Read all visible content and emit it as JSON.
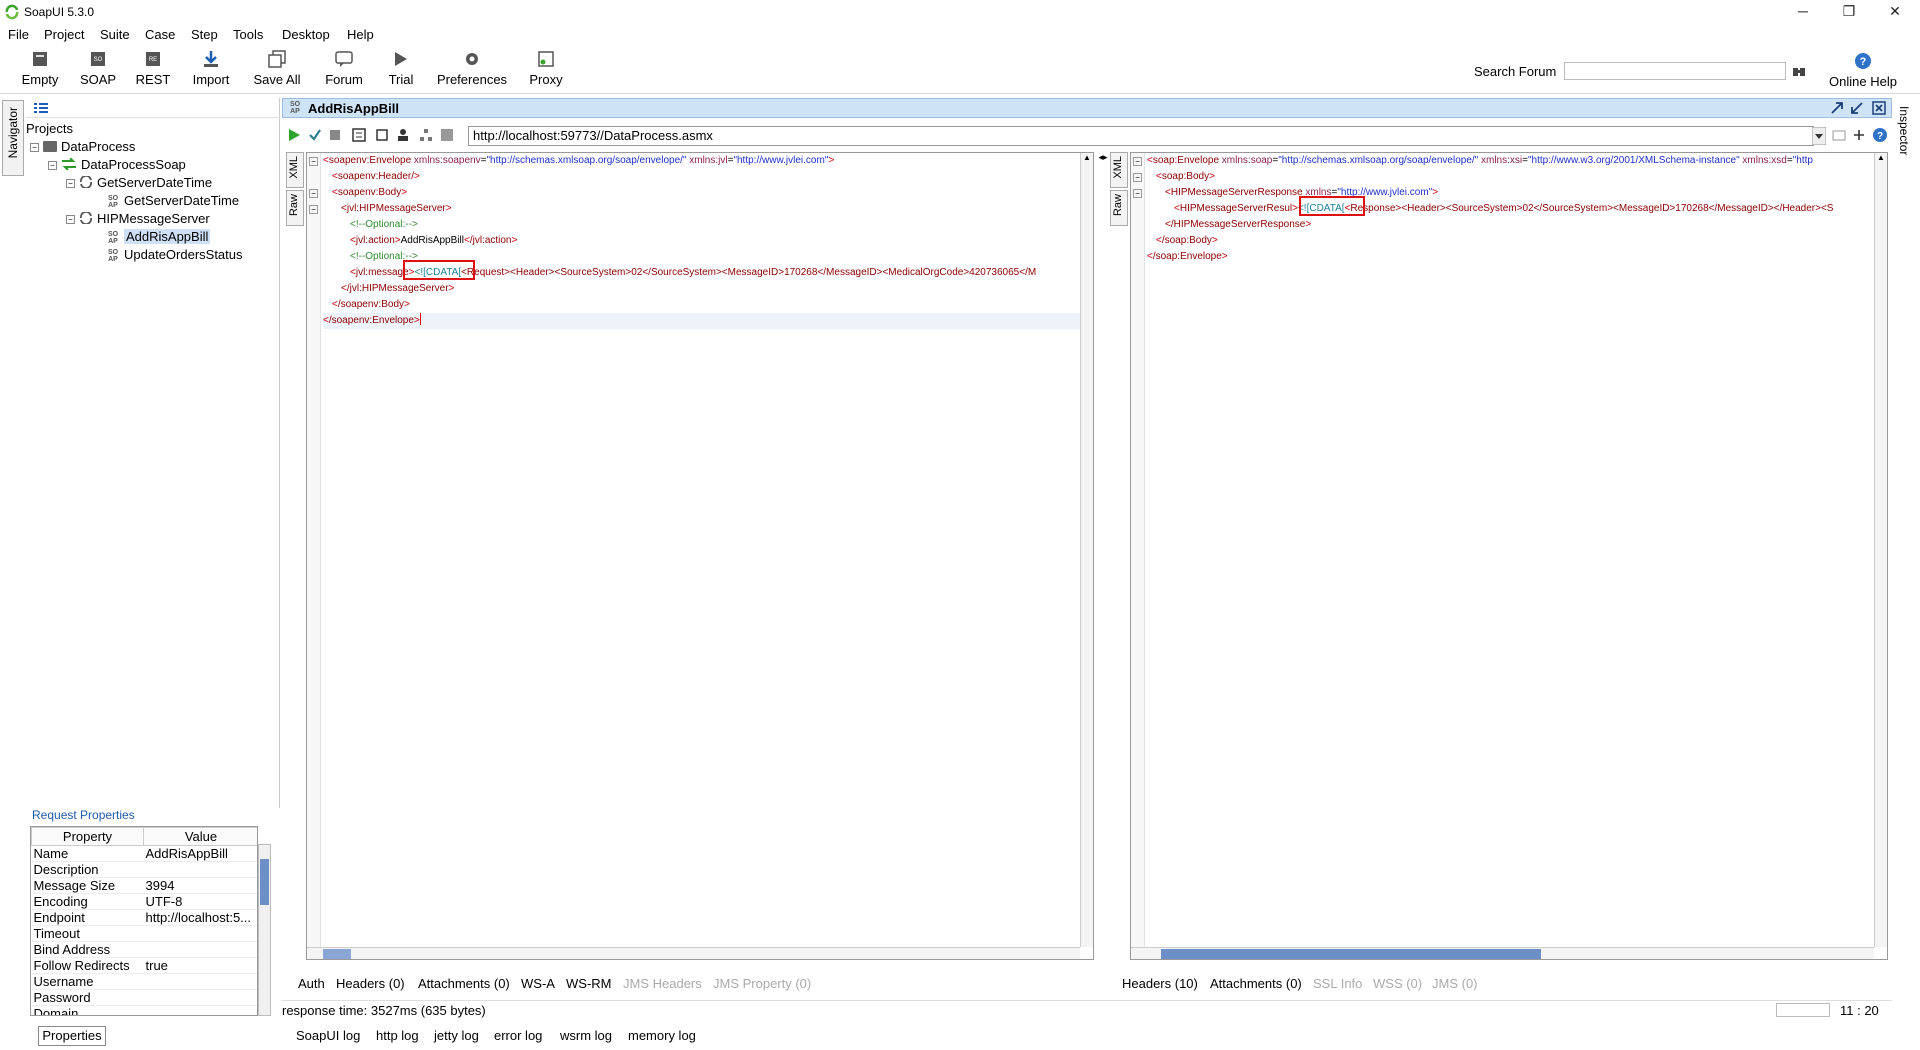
{
  "window": {
    "title": "SoapUI 5.3.0",
    "controls": {
      "minimize": "─",
      "restore": "❐",
      "close": "✕"
    }
  },
  "menu": {
    "items": [
      {
        "label": "File"
      },
      {
        "label": "Project"
      },
      {
        "label": "Suite"
      },
      {
        "label": "Case"
      },
      {
        "label": "Step"
      },
      {
        "label": "Tools"
      },
      {
        "label": "Desktop"
      },
      {
        "label": "Help"
      }
    ]
  },
  "toolbar": {
    "buttons": [
      {
        "label": "Empty",
        "icon": "empty-project-icon"
      },
      {
        "label": "SOAP",
        "icon": "soap-project-icon"
      },
      {
        "label": "REST",
        "icon": "rest-project-icon"
      },
      {
        "label": "Import",
        "icon": "import-icon"
      },
      {
        "label": "Save All",
        "icon": "save-all-icon"
      },
      {
        "label": "Forum",
        "icon": "forum-icon"
      },
      {
        "label": "Trial",
        "icon": "trial-icon"
      },
      {
        "label": "Preferences",
        "icon": "gear-icon"
      },
      {
        "label": "Proxy",
        "icon": "proxy-icon"
      }
    ],
    "search_label": "Search Forum",
    "search_value": "",
    "online_help": "Online Help"
  },
  "side": {
    "navigator": "Navigator",
    "inspector": "Inspector"
  },
  "navigator": {
    "root": "Projects",
    "project": "DataProcess",
    "interface": "DataProcessSoap",
    "operations": [
      {
        "name": "GetServerDateTime",
        "request": "GetServerDateTime"
      },
      {
        "name": "HIPMessageServer",
        "requests": [
          "AddRisAppBill",
          "UpdateOrdersStatus"
        ]
      }
    ],
    "soap_badge_top": "SO",
    "soap_badge_bottom": "AP"
  },
  "request_properties": {
    "title": "Request Properties",
    "headers": [
      "Property",
      "Value"
    ],
    "rows": [
      [
        "Name",
        "AddRisAppBill"
      ],
      [
        "Description",
        ""
      ],
      [
        "Message Size",
        "3994"
      ],
      [
        "Encoding",
        "UTF-8"
      ],
      [
        "Endpoint",
        "http://localhost:5..."
      ],
      [
        "Timeout",
        ""
      ],
      [
        "Bind Address",
        ""
      ],
      [
        "Follow Redirects",
        "true"
      ],
      [
        "Username",
        ""
      ],
      [
        "Password",
        ""
      ],
      [
        "Domain",
        ""
      ]
    ],
    "properties_button": "Properties"
  },
  "editor": {
    "title": "AddRisAppBill",
    "endpoint_url": "http://localhost:59773//DataProcess.asmx",
    "request_tabs": {
      "xml": "XML",
      "raw": "Raw"
    },
    "response_tabs": {
      "xml": "XML",
      "raw": "Raw"
    },
    "request_bottom_tabs": [
      {
        "label": "Auth",
        "enabled": true
      },
      {
        "label": "Headers (0)",
        "enabled": true
      },
      {
        "label": "Attachments (0)",
        "enabled": true
      },
      {
        "label": "WS-A",
        "enabled": true
      },
      {
        "label": "WS-RM",
        "enabled": true
      },
      {
        "label": "JMS Headers",
        "enabled": false
      },
      {
        "label": "JMS Property (0)",
        "enabled": false
      }
    ],
    "response_bottom_tabs": [
      {
        "label": "Headers (10)",
        "enabled": true
      },
      {
        "label": "Attachments (0)",
        "enabled": true
      },
      {
        "label": "SSL Info",
        "enabled": false
      },
      {
        "label": "WSS (0)",
        "enabled": false
      },
      {
        "label": "JMS (0)",
        "enabled": false
      }
    ]
  },
  "request_xml": {
    "line1_tag": "soapenv:Envelope",
    "line1_attr1_name": "xmlns:soapenv",
    "line1_attr1_value": "\"http://schemas.xmlsoap.org/soap/envelope/\"",
    "line1_attr2_name": "xmlns:jvl",
    "line1_attr2_value": "\"http://www.jvlei.com\"",
    "header": "soapenv:Header/",
    "body": "soapenv:Body",
    "server": "jvl:HIPMessageServer",
    "optional1": "<!--Optional:-->",
    "action_tag": "jvl:action",
    "action_value": "AddRisAppBill",
    "action_close": "/jvl:action",
    "optional2": "<!--Optional:-->",
    "message_tag": "jvl:message",
    "cdata": "<![CDATA[",
    "message_rest": "<Request><Header><SourceSystem>02</SourceSystem><MessageID>170268</MessageID><MedicalOrgCode>420736065</M",
    "server_close": "/jvl:HIPMessageServer",
    "body_close": "/soapenv:Body",
    "envelope_close": "/soapenv:Envelope"
  },
  "response_xml": {
    "line1_tag": "soap:Envelope",
    "line1_attr1_name": "xmlns:soap",
    "line1_attr1_value": "\"http://schemas.xmlsoap.org/soap/envelope/\"",
    "line1_attr2_name": "xmlns:xsi",
    "line1_attr2_value": "\"http://www.w3.org/2001/XMLSchema-instance\"",
    "line1_attr3_name": "xmlns:xsd",
    "line1_attr3_value": "\"http",
    "body": "soap:Body",
    "resp_tag": "HIPMessageServerResponse",
    "resp_attr_name": "xmlns",
    "resp_attr_value": "\"http://www.jvlei.com\"",
    "result_tag": "HIPMessageServerResul",
    "cdata": "<![CDATA[",
    "result_rest": "Response><Header><SourceSystem>02</SourceSystem><MessageID>170268</MessageID></Header><S",
    "resp_close": "/HIPMessageServerResponse",
    "body_close": "/soap:Body",
    "envelope_close": "/soap:Envelope"
  },
  "status": {
    "response_time": "response time: 3527ms (635 bytes)",
    "position": "11 : 20"
  },
  "log_tabs": [
    {
      "label": "SoapUI log"
    },
    {
      "label": "http log"
    },
    {
      "label": "jetty log"
    },
    {
      "label": "error log"
    },
    {
      "label": "wsrm log"
    },
    {
      "label": "memory log"
    }
  ],
  "colors": {
    "tag": "#8b0000",
    "attr_value": "#1e2fc8",
    "comment": "#2e8b2e",
    "cdata": "#1e7f9a",
    "highlight_box": "#e01010",
    "header_bar": "#cfe3f6",
    "selection": "#cfe0f6"
  }
}
